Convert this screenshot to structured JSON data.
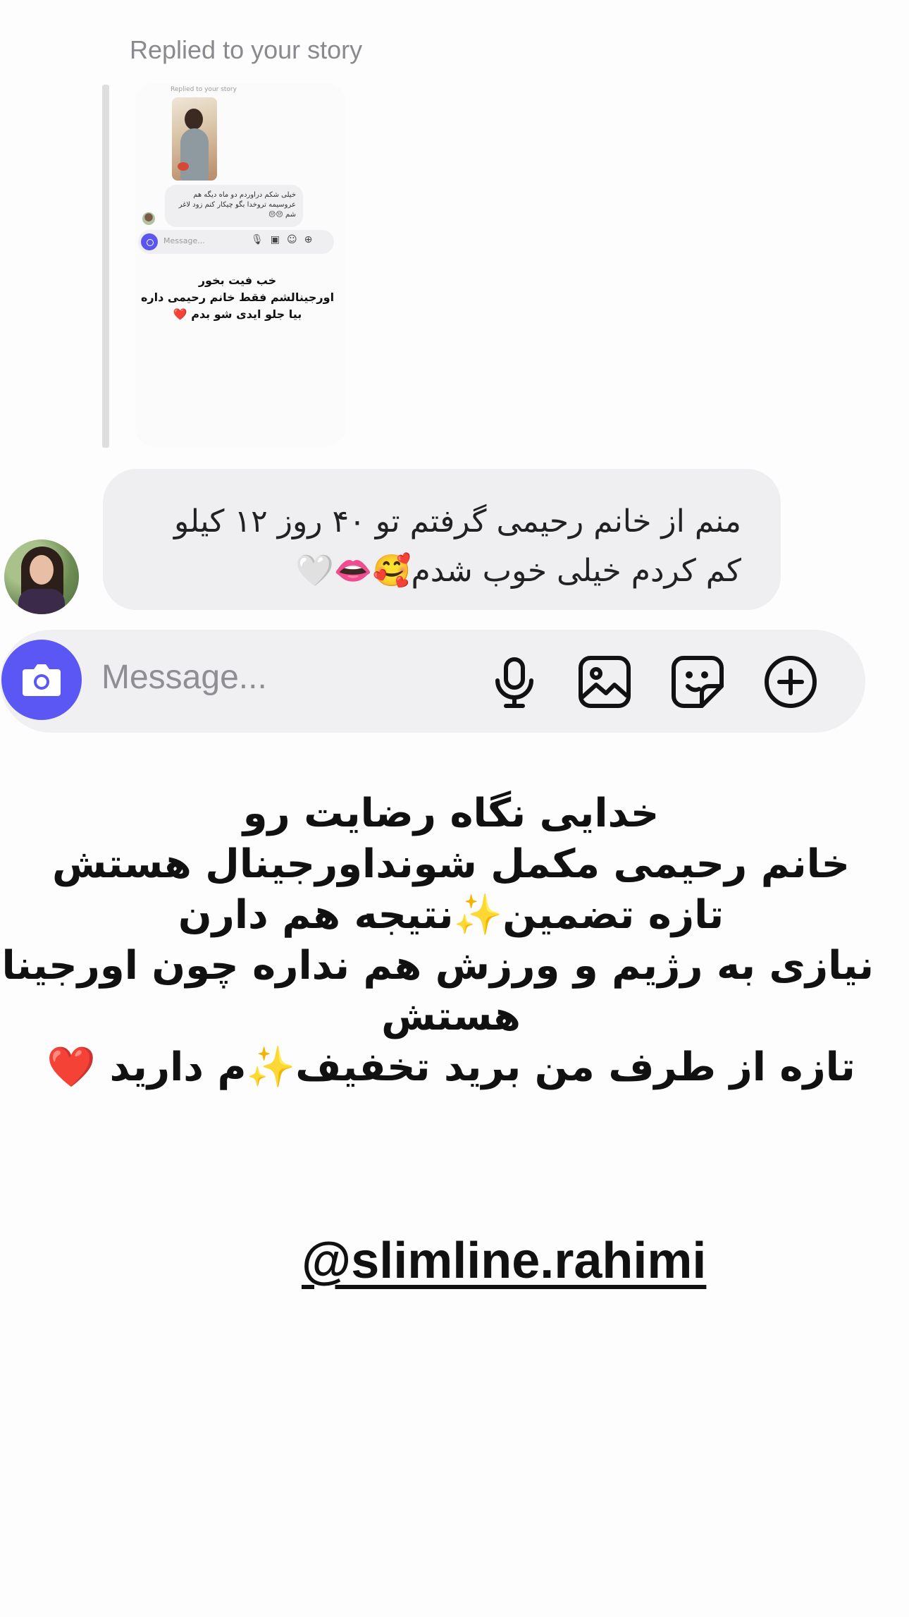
{
  "story_reply": {
    "label": "Replied to your story",
    "preview": {
      "label": "Replied to your story",
      "message": "خیلی شکم دراوردم دو ماه دیگه هم عروسیمه تروخدا بگو چیکار کنم زود لاغر شم 😔😔",
      "input_placeholder": "Message...",
      "caption_lines": [
        "خب فیت بخور",
        "اورجینالشم فقط خانم رحیمی داره",
        "بیا جلو ایدی شو بدم ❤️"
      ]
    }
  },
  "message": {
    "line1": "منم از خانم رحیمی گرفتم تو ۴۰ روز ۱۲ کیلو",
    "line2": "کم کردم خیلی خوب شدم🥰👄🤍"
  },
  "composer": {
    "placeholder": "Message...",
    "icons": [
      "camera-icon",
      "microphone-icon",
      "gallery-icon",
      "sticker-icon",
      "plus-icon"
    ],
    "accent": "#5b57f5"
  },
  "caption": {
    "lines": [
      "خدایی نگاه رضایت رو",
      "خانم رحیمی مکمل شونداورجینال هستش",
      "تازه تضمین✨نتیجه هم دارن",
      "نیازی به رژیم و ورزش هم نداره چون اورجینال",
      "هستش",
      "تازه از طرف من برید تخفیف✨م دارید ❤️"
    ]
  },
  "handle": "@slimline.rahimi"
}
